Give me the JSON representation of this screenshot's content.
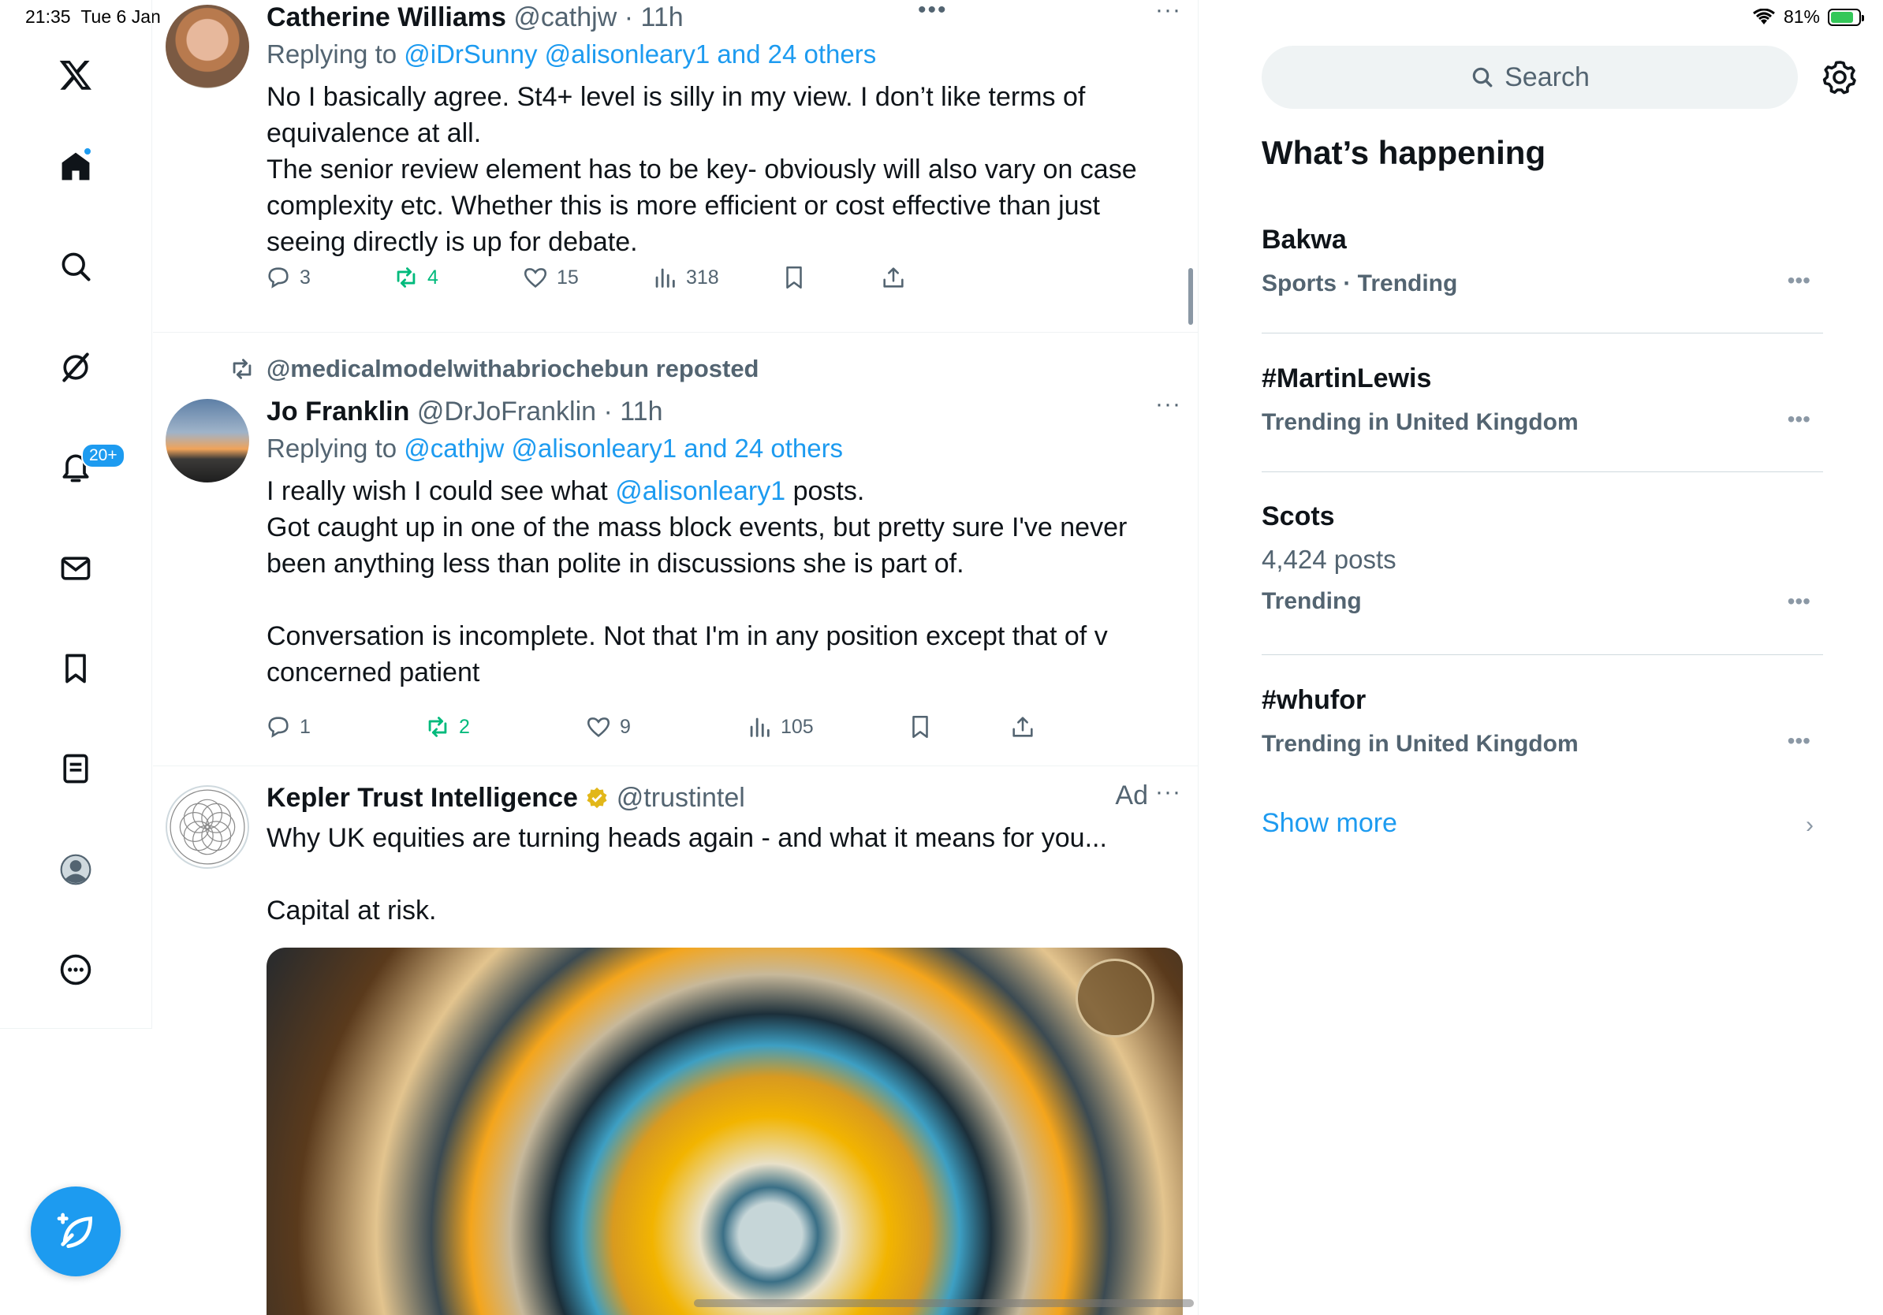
{
  "status": {
    "time": "21:35",
    "date": "Tue 6 Jan",
    "battery": "81%",
    "battery_level": 0.81
  },
  "nav": {
    "notifications_badge": "20+",
    "items": [
      "x-logo",
      "home",
      "explore",
      "grok",
      "notifications",
      "messages",
      "bookmarks",
      "lists",
      "profile",
      "more"
    ]
  },
  "tweets": [
    {
      "name": "Catherine Williams",
      "handle": "@cathjw",
      "time": "· 11h",
      "replying_prefix": "Replying to ",
      "replying_to": "@iDrSunny @alisonleary1 and 24 others",
      "text": [
        "No I basically agree. St4+ level is silly in my view. I don’t like terms of equivalence at all.",
        "The senior review element has to be key- obviously will also vary on case complexity etc. Whether this is more efficient or cost effective than just seeing directly is up for debate."
      ],
      "replies": "3",
      "reposts": "4",
      "likes": "15",
      "views": "318"
    },
    {
      "reposted_by": "@medicalmodelwithabriochebun reposted",
      "name": "Jo Franklin",
      "handle": "@DrJoFranklin",
      "time": "· 11h",
      "replying_prefix": "Replying to ",
      "replying_to": "@cathjw @alisonleary1 and 24 others",
      "text_pre": "I really wish I could see what ",
      "text_mention": "@alisonleary1",
      "text_post": " posts.",
      "text": [
        "Got caught up in one of the mass block events, but pretty sure I've never been anything less than polite in discussions she is part of.",
        "",
        "Conversation is incomplete. Not that I'm in any position except that of v concerned patient"
      ],
      "replies": "1",
      "reposts": "2",
      "likes": "9",
      "views": "105"
    },
    {
      "name": "Kepler Trust Intelligence",
      "handle": "@trustintel",
      "ad_label": "Ad",
      "text": [
        "Why UK equities are turning heads again - and what it means for you...",
        "",
        "Capital at risk."
      ]
    }
  ],
  "sidebar": {
    "search_placeholder": "Search",
    "title": "What’s happening",
    "trends": [
      {
        "name": "Bakwa",
        "meta": "Sports · Trending"
      },
      {
        "name": "#MartinLewis",
        "meta": "Trending in United Kingdom"
      },
      {
        "name": "Scots",
        "count": "4,424 posts",
        "meta": "Trending"
      },
      {
        "name": "#whufor",
        "meta": "Trending in United Kingdom"
      }
    ],
    "show_more": "Show more"
  },
  "colors": {
    "accent": "#1d9bf0",
    "repost_green": "#00ba7c",
    "muted": "#536471",
    "text": "#0f1419"
  }
}
